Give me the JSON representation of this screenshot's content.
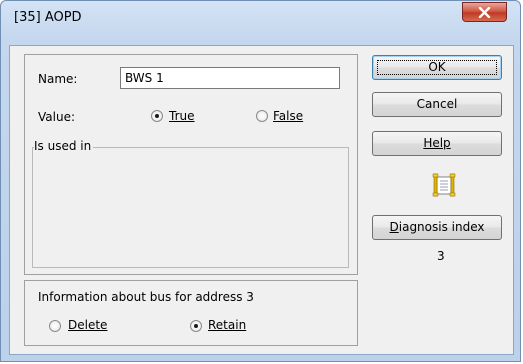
{
  "window": {
    "title": "[35] AOPD"
  },
  "form": {
    "name_label": "Name:",
    "name_value": "BWS 1",
    "value_label": "Value:",
    "options": [
      {
        "label": "True",
        "selected": true
      },
      {
        "label": "False",
        "selected": false
      }
    ]
  },
  "used_in": {
    "label": "Is used in",
    "items": []
  },
  "bus_info": {
    "label": "Information about bus for address 3",
    "options": [
      {
        "label": "Delete",
        "selected": false
      },
      {
        "label": "Retain",
        "selected": true
      }
    ]
  },
  "buttons": {
    "ok": "OK",
    "cancel": "Cancel",
    "help": "Help",
    "diagnosis": "Diagnosis index"
  },
  "diagnosis_value": "3",
  "icons": {
    "close": "close-icon",
    "diagnosis": "document-scroll-icon"
  }
}
